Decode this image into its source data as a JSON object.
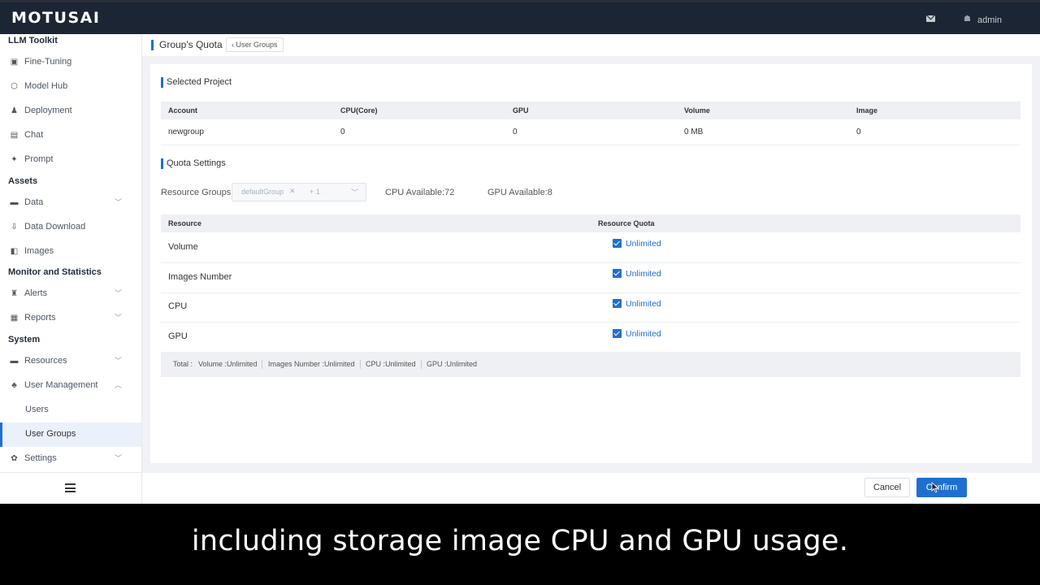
{
  "app": {
    "logo": "MOTUSAI",
    "user": "admin"
  },
  "sidebar": {
    "sections": [
      {
        "title": "LLM Toolkit"
      },
      {
        "title": "Assets"
      },
      {
        "title": "Monitor and Statistics"
      },
      {
        "title": "System"
      }
    ],
    "items": [
      {
        "label": "Fine-Tuning",
        "icon": "fine-tuning-icon"
      },
      {
        "label": "Model Hub",
        "icon": "cube-icon"
      },
      {
        "label": "Deployment",
        "icon": "deploy-icon"
      },
      {
        "label": "Chat",
        "icon": "chat-icon"
      },
      {
        "label": "Prompt",
        "icon": "pin-icon"
      },
      {
        "label": "Data",
        "icon": "folder-icon"
      },
      {
        "label": "Data Download",
        "icon": "download-icon"
      },
      {
        "label": "Images",
        "icon": "image-icon"
      },
      {
        "label": "Alerts",
        "icon": "alert-icon"
      },
      {
        "label": "Reports",
        "icon": "report-icon"
      },
      {
        "label": "Resources",
        "icon": "resources-icon"
      },
      {
        "label": "User Management",
        "icon": "users-icon"
      },
      {
        "label": "Users"
      },
      {
        "label": "User Groups",
        "active": true
      },
      {
        "label": "Settings",
        "icon": "gear-icon"
      }
    ]
  },
  "header": {
    "title": "Group's Quota",
    "back_label": "User Groups"
  },
  "selected_project": {
    "title": "Selected Project",
    "columns": [
      "Account",
      "CPU(Core)",
      "GPU",
      "Volume",
      "Image"
    ],
    "row": [
      "newgroup",
      "0",
      "0",
      "0 MB",
      "0"
    ]
  },
  "quota_settings": {
    "title": "Quota Settings",
    "resource_groups_label": "Resource Groups",
    "selected_tag": "defaultGroup",
    "more_tag": "+ 1",
    "cpu_available": "CPU Available:72",
    "gpu_available": "GPU Available:8",
    "columns": [
      "Resource",
      "Resource Quota"
    ],
    "rows": [
      {
        "resource": "Volume",
        "quota": "Unlimited",
        "checked": true
      },
      {
        "resource": "Images Number",
        "quota": "Unlimited",
        "checked": true
      },
      {
        "resource": "CPU",
        "quota": "Unlimited",
        "checked": true
      },
      {
        "resource": "GPU",
        "quota": "Unlimited",
        "checked": true
      }
    ],
    "total": {
      "label": "Total :",
      "items": [
        "Volume :Unlimited",
        "Images Number :Unlimited",
        "CPU :Unlimited",
        "GPU :Unlimited"
      ]
    }
  },
  "footer": {
    "cancel_label": "Cancel",
    "confirm_label": "Confirm"
  },
  "caption": "including storage  image  CPU and GPU usage.",
  "colors": {
    "accent": "#1f6fd0",
    "topbar": "#1c2533"
  }
}
